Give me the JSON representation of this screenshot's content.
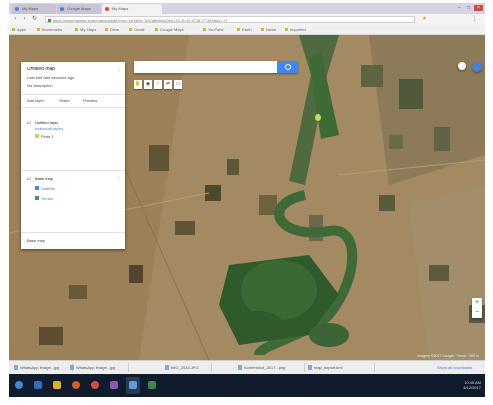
{
  "browser": {
    "tabs": [
      {
        "label": "My Maps",
        "active": false
      },
      {
        "label": "Google Maps",
        "active": false
      },
      {
        "label": "My Maps",
        "active": true
      }
    ],
    "window_controls": {
      "minimize": "–",
      "maximize": "□",
      "close": "×"
    },
    "nav": {
      "back": "‹",
      "forward": "›",
      "reload": "↻"
    },
    "url": "https://www.google.com/maps/d/edit?mid=1xHdMz_b9Za0tWnsQ8rLOG-ll=12.9716,77.5946&z=17",
    "bookmarks": [
      "Apps",
      "Bookmarks",
      "My Maps",
      "Drive",
      "Gmail",
      "Google Maps",
      "YouTube",
      "Earth",
      "News",
      "Imported"
    ]
  },
  "map": {
    "search_placeholder": "",
    "tool_icons": [
      "hand-icon",
      "marker-icon",
      "line-icon",
      "route-icon",
      "ruler-icon"
    ],
    "footer": "Imagery ©2017 Google · Terms · 200 m"
  },
  "panel": {
    "title": "Untitled map",
    "meta": "Last edit was seconds ago",
    "description": "No description",
    "actions": [
      "Add layer",
      "Share",
      "Preview"
    ],
    "layer1_name": "Untitled layer",
    "layer1_style": "Individual styles",
    "layer1_item": "Point 1",
    "layer2_name": "Base map",
    "layer2_item1": "Satellite",
    "layer2_item2": "Terrain",
    "footer": "Base map"
  },
  "downloads": [
    "WhatsApp Image...jpg",
    "WhatsApp Image...jpg",
    "IMG_2034.JPG",
    "Screenshot_2017...png",
    "map_export.kml"
  ],
  "downloads_show_all": "Show all downloads",
  "taskbar": {
    "apps": [
      "start-icon",
      "explorer-icon",
      "chrome-icon",
      "folder-icon",
      "media-icon",
      "word-icon",
      "paint-icon",
      "photos-icon"
    ],
    "time": "10:45 AM",
    "date": "4/12/2017"
  },
  "colors": {
    "accent": "#4285f4",
    "pin": "#b8e05a",
    "taskbar": "#101c2e"
  }
}
